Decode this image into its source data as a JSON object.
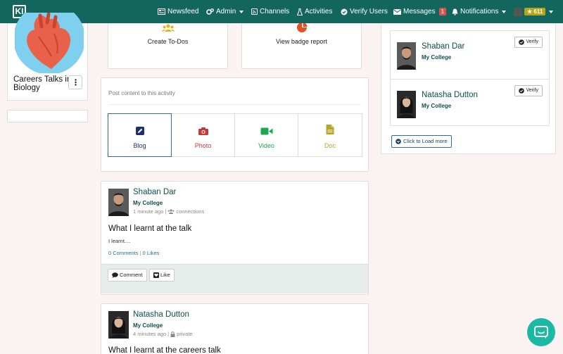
{
  "nav": {
    "logo": "KI",
    "newsfeed": "Newsfeed",
    "admin": "Admin",
    "channels": "Channels",
    "activities": "Activities",
    "verify_users": "Verify Users",
    "messages": "Messages",
    "messages_count": "1",
    "notifications": "Notifications",
    "points": "611"
  },
  "activity": {
    "title": "Careers Talks in Biology"
  },
  "actions": {
    "create_todos": "Create To-Dos",
    "view_badge_report": "View badge report"
  },
  "post_box": {
    "prompt": "Post content to this activity",
    "tiles": [
      {
        "label": "Blog",
        "color": "#1d2f6f"
      },
      {
        "label": "Photo",
        "color": "#c23a3a"
      },
      {
        "label": "Video",
        "color": "#1ea651"
      },
      {
        "label": "Doc",
        "color": "#b5a628"
      }
    ]
  },
  "feed": [
    {
      "author": "Shaban Dar",
      "college": "My College",
      "time": "1 minute ago",
      "visibility": "connections",
      "title": "What I learnt at the talk",
      "body": "I learnt....",
      "comments": "0 Comments",
      "likes": "0 Likes",
      "comment_btn": "Comment",
      "like_btn": "Like"
    },
    {
      "author": "Natasha Dutton",
      "college": "My College",
      "time": "4 minutes ago",
      "visibility": "private",
      "title": "What I learnt at the careers talk"
    }
  ],
  "verify_panel": {
    "people": [
      {
        "name": "Shaban Dar",
        "college": "My College",
        "button": "Verify"
      },
      {
        "name": "Natasha Dutton",
        "college": "My College",
        "button": "Verify"
      }
    ],
    "load_more": "Click to Load more"
  },
  "colors": {
    "navbar": "#12665e",
    "accent_text": "#0e4f4b",
    "chat": "#1ab9a4"
  }
}
